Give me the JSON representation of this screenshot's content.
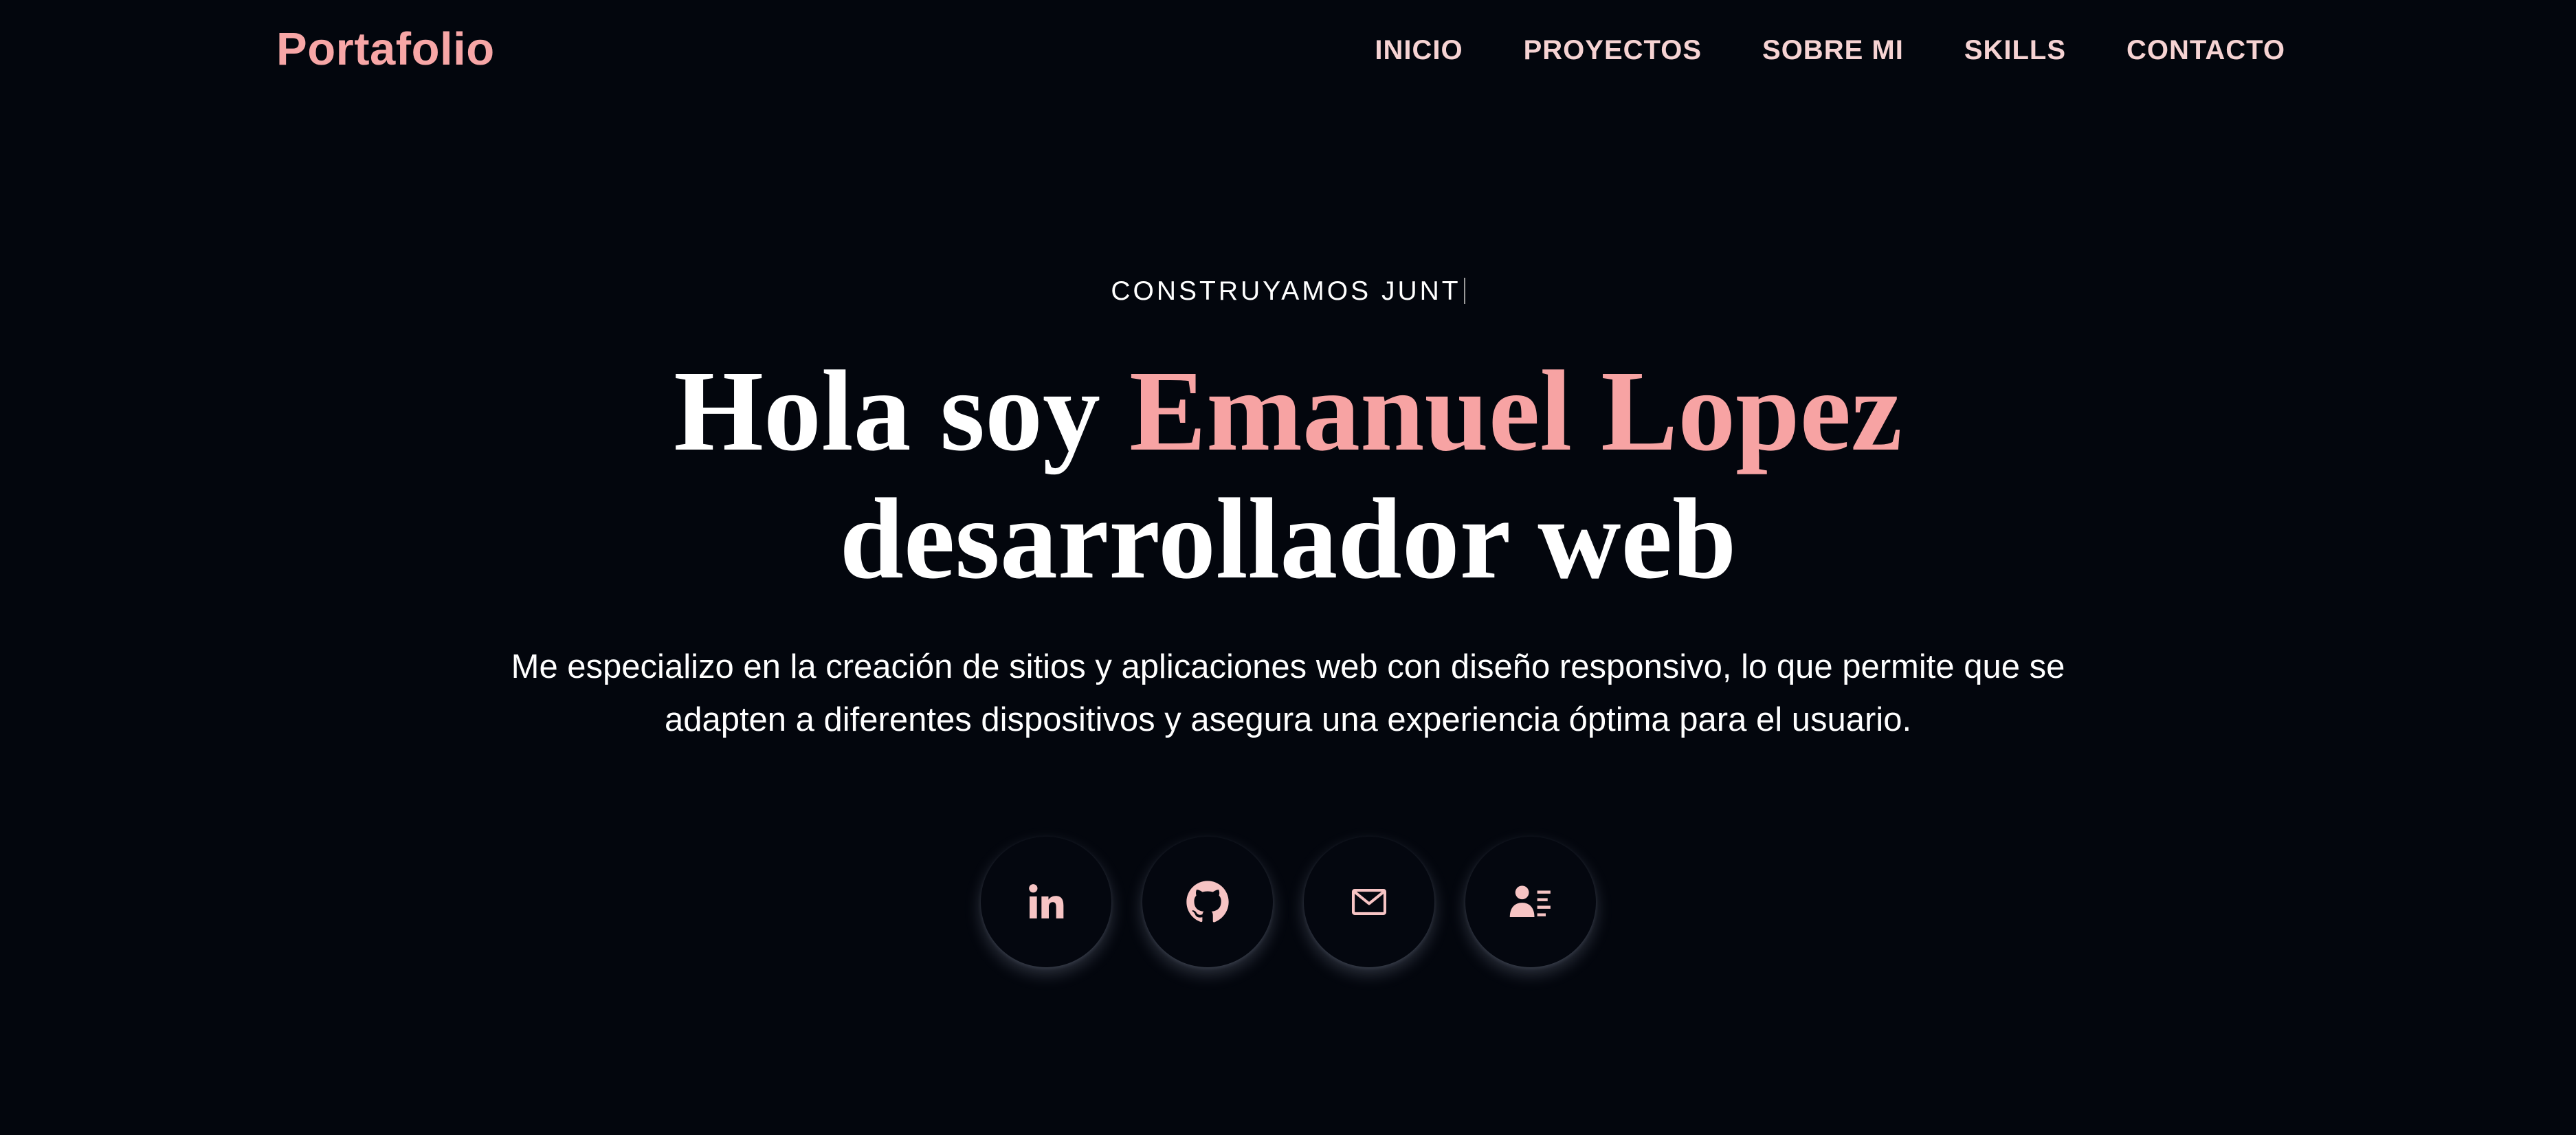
{
  "header": {
    "logo": "Portafolio",
    "nav": [
      {
        "label": "INICIO"
      },
      {
        "label": "PROYECTOS"
      },
      {
        "label": "SOBRE MI"
      },
      {
        "label": "SKILLS"
      },
      {
        "label": "CONTACTO"
      }
    ]
  },
  "hero": {
    "tagline": "CONSTRUYAMOS JUNT",
    "title_prefix": "Hola soy ",
    "title_name": "Emanuel Lopez",
    "title_suffix": "desarrollador web",
    "description": "Me especializo en la creación de sitios y aplicaciones web con diseño responsivo, lo que permite que se adapten a diferentes dispositivos y asegura una experiencia óptima para el usuario."
  },
  "social": [
    {
      "icon": "linkedin-icon"
    },
    {
      "icon": "github-icon"
    },
    {
      "icon": "mail-icon"
    },
    {
      "icon": "contact-card-icon"
    }
  ],
  "colors": {
    "background": "#03060d",
    "accent": "#f7a3a3",
    "nav_text": "#f6d3d3",
    "text": "#ffffff"
  }
}
